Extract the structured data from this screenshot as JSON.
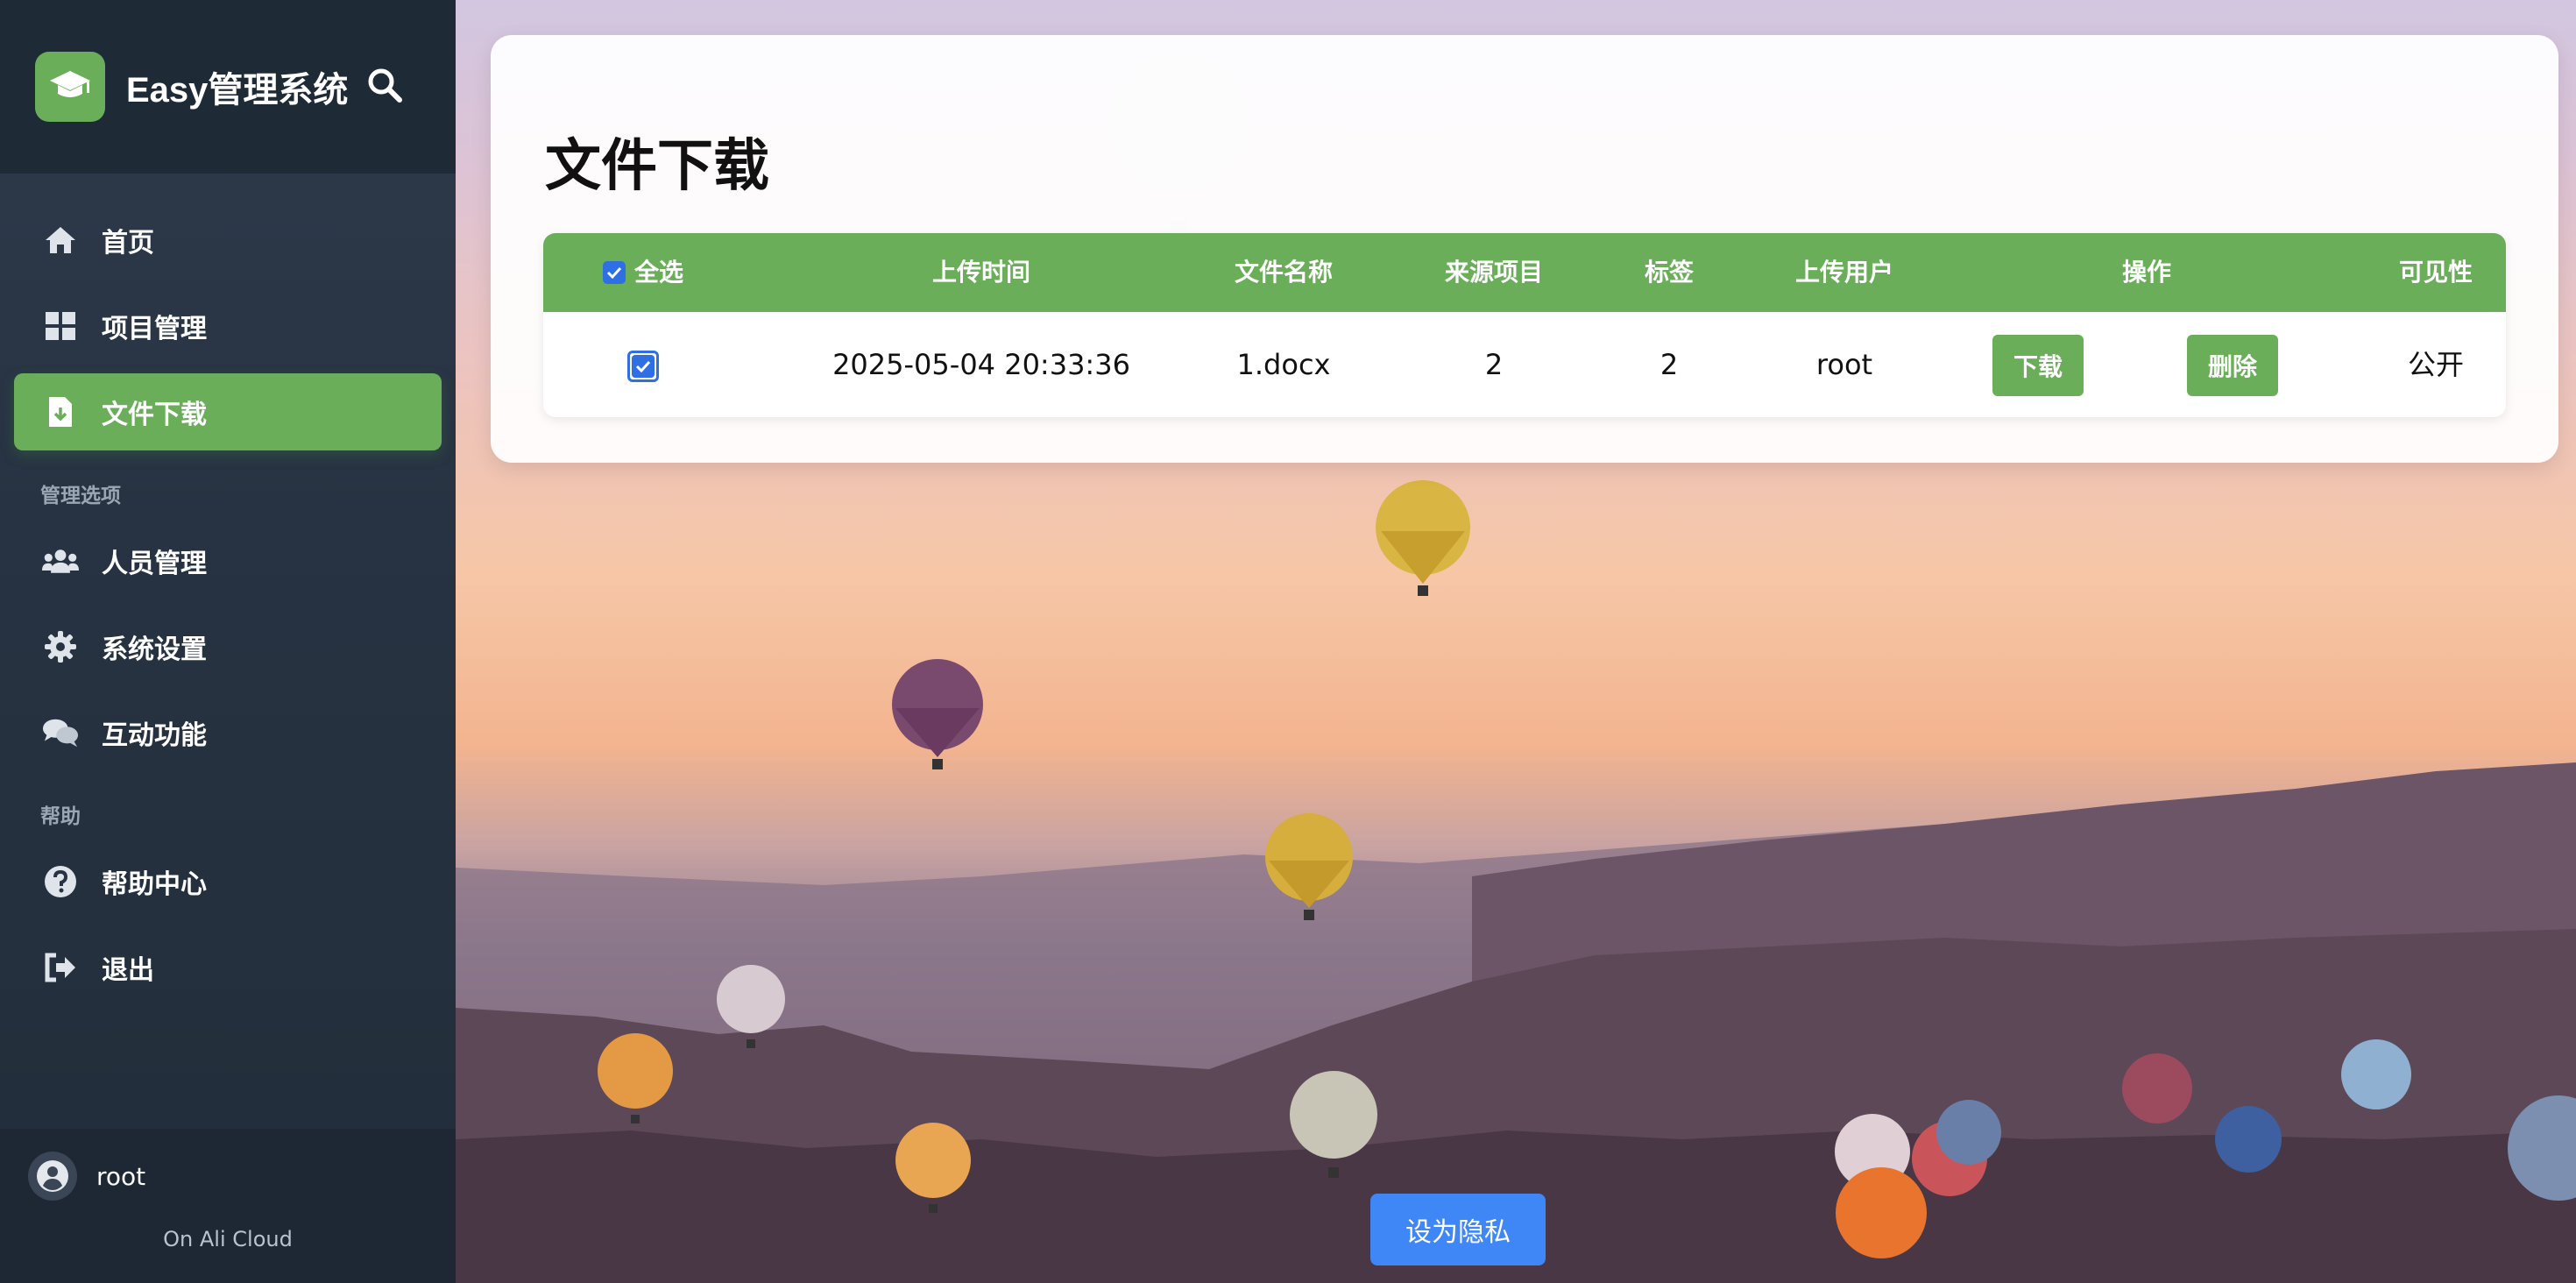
{
  "brand": {
    "title": "Easy管理系统"
  },
  "nav": {
    "home": "首页",
    "projects": "项目管理",
    "downloads": "文件下载",
    "section_manage": "管理选项",
    "people": "人员管理",
    "settings": "系统设置",
    "interact": "互动功能",
    "section_help": "帮助",
    "help_center": "帮助中心",
    "logout": "退出"
  },
  "user": {
    "name": "root",
    "host": "On Ali Cloud"
  },
  "page": {
    "title": "文件下载"
  },
  "table": {
    "headers": {
      "select_all": "全选",
      "upload_time": "上传时间",
      "file_name": "文件名称",
      "source_project": "来源项目",
      "tag": "标签",
      "uploader": "上传用户",
      "actions": "操作",
      "visibility": "可见性"
    },
    "rows": [
      {
        "upload_time": "2025-05-04 20:33:36",
        "file_name": "1.docx",
        "source_project": "2",
        "tag": "2",
        "uploader": "root",
        "download_label": "下载",
        "delete_label": "删除",
        "visibility": "公开",
        "selected": true
      }
    ]
  },
  "actions": {
    "set_private": "设为隐私"
  },
  "colors": {
    "accent_green": "#6aae5a",
    "primary_blue": "#3f86f7",
    "sidebar_bg": "#273342"
  }
}
